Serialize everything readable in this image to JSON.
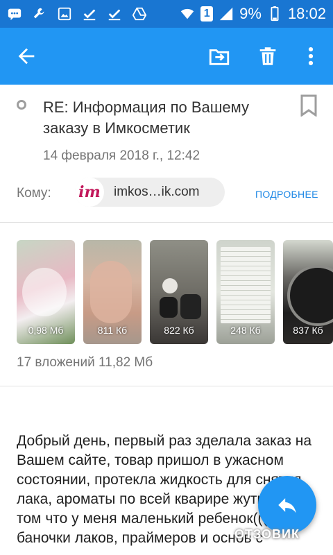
{
  "status_bar": {
    "battery": "9%",
    "time": "18:02",
    "sim": "1",
    "icons": [
      "message-icon",
      "wrench-icon",
      "image-icon",
      "check-icon",
      "check-icon",
      "drive-icon",
      "wifi-icon",
      "sim-icon",
      "signal-icon",
      "battery-icon"
    ]
  },
  "app_bar": {
    "icons": [
      "arrow-back-icon",
      "move-to-folder-icon",
      "trash-icon",
      "more-vert-icon"
    ]
  },
  "message": {
    "subject": "RE: Информация по Вашему заказу в Имкосметик",
    "date": "14 февраля 2018 г., 12:42",
    "to_label": "Кому:",
    "recipient_avatar": "im",
    "recipient_email": "imkos…ik.com",
    "details_link": "ПОДРОБНЕЕ"
  },
  "attachments": {
    "items": [
      {
        "size": "0,98 Мб"
      },
      {
        "size": "811 Кб"
      },
      {
        "size": "822 Кб"
      },
      {
        "size": "248 Кб"
      },
      {
        "size": "837 Кб"
      }
    ],
    "summary": "17 вложений 11,82 Мб"
  },
  "body_text": "Добрый день, первый раз зделала заказ на Вашем сайте, товар пришол в ужасном состоянии, протекла жидкость для снятия лака, ароматы по всей кварире жуткие, при том что у меня маленький ребенок(((( все баночки лаков, праймеров и основ с",
  "watermark": "ОТЗОВИК",
  "colors": {
    "status_bar": "#1976d2",
    "app_bar": "#2196f3",
    "accent": "#1e88e5"
  }
}
